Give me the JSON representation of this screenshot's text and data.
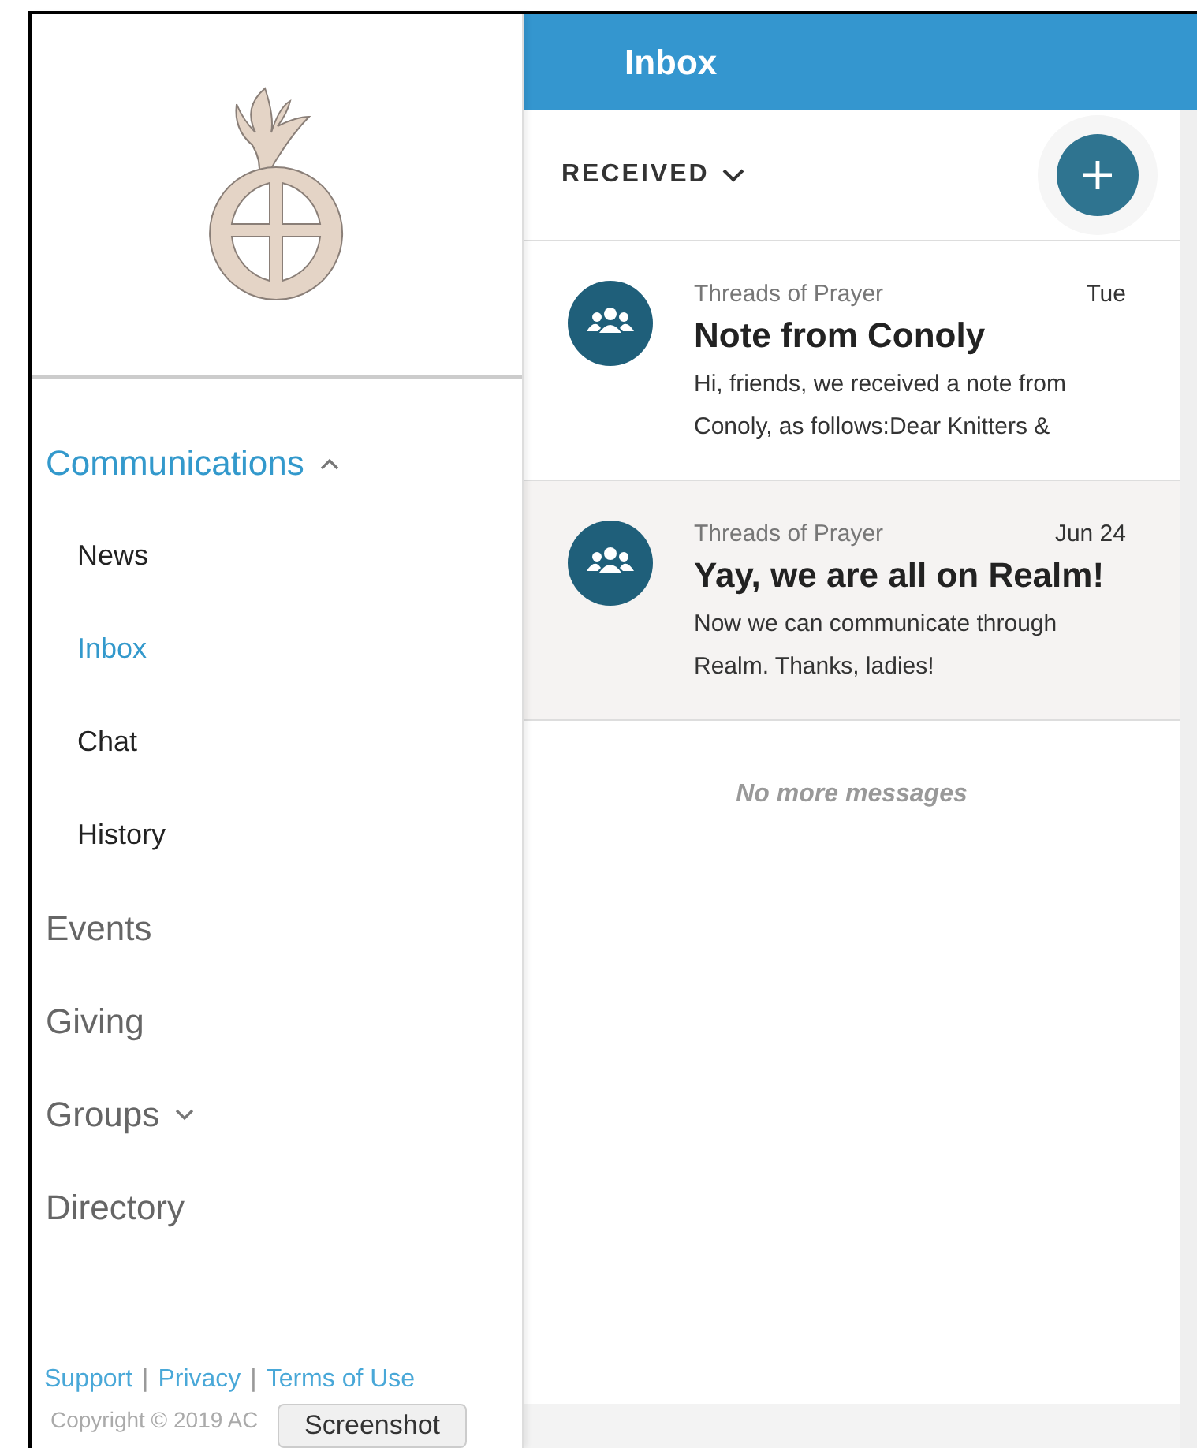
{
  "sidebar": {
    "nav": [
      {
        "label": "Communications",
        "selected": true,
        "expanded": true,
        "children": [
          {
            "label": "News",
            "selected": false
          },
          {
            "label": "Inbox",
            "selected": true
          },
          {
            "label": "Chat",
            "selected": false
          },
          {
            "label": "History",
            "selected": false
          }
        ]
      },
      {
        "label": "Events",
        "selected": false
      },
      {
        "label": "Giving",
        "selected": false
      },
      {
        "label": "Groups",
        "selected": false,
        "expanded": false
      },
      {
        "label": "Directory",
        "selected": false
      }
    ],
    "footer_links": [
      "Support",
      "Privacy",
      "Terms of Use"
    ],
    "link_separator": "|",
    "copyright": "Copyright © 2019 AC"
  },
  "header": {
    "title": "Inbox"
  },
  "toolbar": {
    "filter": "RECEIVED"
  },
  "messages": [
    {
      "group": "Threads of Prayer",
      "date": "Tue",
      "subject": "Note from Conoly",
      "preview": "Hi, friends, we received a note from Conoly, as follows:Dear Knitters &",
      "selected": false
    },
    {
      "group": "Threads of Prayer",
      "date": "Jun 24",
      "subject": "Yay, we are all on Realm!",
      "preview": "Now we can communicate through Realm.  Thanks, ladies!",
      "selected": true
    }
  ],
  "end_note": "No more messages",
  "tooltip": "Screenshot"
}
